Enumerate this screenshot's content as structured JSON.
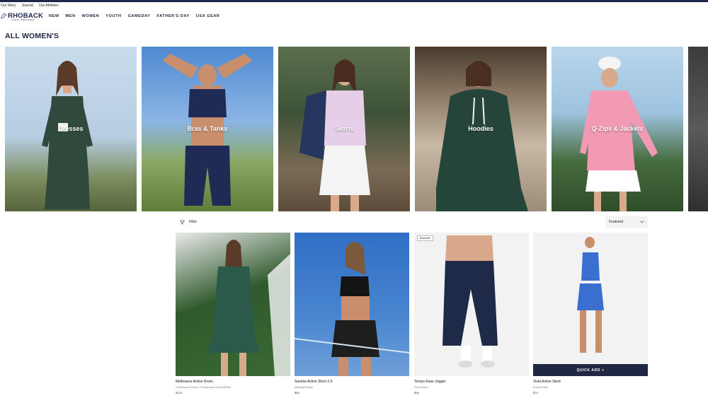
{
  "utility_links": [
    "Our Story",
    "Journal",
    "Our Athletes"
  ],
  "brand": {
    "name": "RHOBACK",
    "tagline": "COAST WELLNESS"
  },
  "nav": [
    "NEW",
    "MEN",
    "WOMEN",
    "YOUTH",
    "GAMEDAY",
    "FATHER'S DAY",
    "USA GEAR"
  ],
  "page_title": "ALL WOMEN'S",
  "categories": [
    {
      "label": "Dresses"
    },
    {
      "label": "Bras & Tanks"
    },
    {
      "label": "Skorts"
    },
    {
      "label": "Hoodies"
    },
    {
      "label": "Q-Zips & Jackets"
    }
  ],
  "filter": {
    "label": "Filter"
  },
  "sort": {
    "value": "Featured"
  },
  "products": [
    {
      "name": "Melbourne Active Dress",
      "color": "Ponderosa Green / Ponderosa Green/White",
      "price": "$124"
    },
    {
      "name": "Sunrise Active Short 2.0",
      "color": "Midnight Black",
      "price": "$58"
    },
    {
      "name": "Tempo Ease Jogger",
      "color": "Fleet Navy",
      "price": "$96",
      "badge": "Bestseller"
    },
    {
      "name": "Vista Active Skort",
      "color": "Evolve Blue",
      "price": "$74",
      "quick_add": "QUICK ADD +"
    }
  ],
  "colors": {
    "navy": "#1e2749",
    "quick_add_bg": "#1f2745"
  }
}
